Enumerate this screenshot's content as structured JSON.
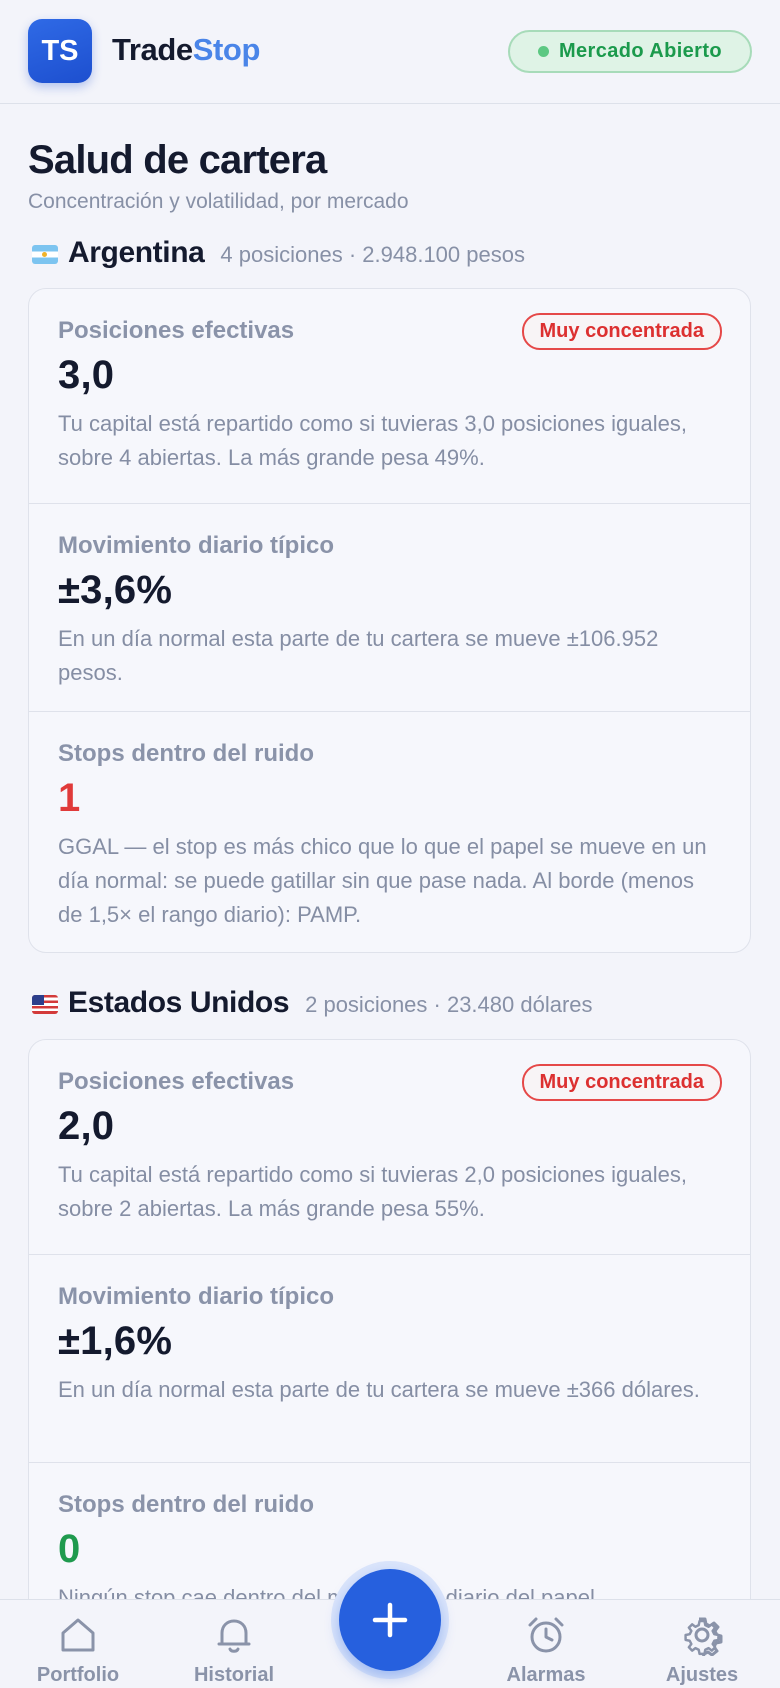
{
  "header": {
    "logo_text": "TS",
    "brand_part1": "Trade",
    "brand_part2": "Stop",
    "market_status": "Mercado Abierto"
  },
  "page": {
    "title": "Salud de cartera",
    "subtitle": "Concentración y volatilidad, por mercado"
  },
  "markets": [
    {
      "name": "Argentina",
      "flag": "argentina-flag",
      "meta": "4 posiciones · 2.948.100 pesos",
      "metrics": {
        "effective": {
          "label": "Posiciones efectivas",
          "badge": "Muy concentrada",
          "value": "3,0",
          "desc": "Tu capital está repartido como si tuvieras 3,0 posiciones iguales, sobre 4 abiertas. La más grande pesa 49%."
        },
        "daily": {
          "label": "Movimiento diario típico",
          "value": "±3,6%",
          "desc": "En un día normal esta parte de tu cartera se mueve ±106.952 pesos."
        },
        "stops": {
          "label": "Stops dentro del ruido",
          "value": "1",
          "desc": "GGAL — el stop es más chico que lo que el papel se mueve en un día normal: se puede gatillar sin que pase nada. Al borde (menos de 1,5× el rango diario): PAMP."
        }
      }
    },
    {
      "name": "Estados Unidos",
      "flag": "usa-flag",
      "meta": "2 posiciones · 23.480 dólares",
      "metrics": {
        "effective": {
          "label": "Posiciones efectivas",
          "badge": "Muy concentrada",
          "value": "2,0",
          "desc": "Tu capital está repartido como si tuvieras 2,0 posiciones iguales, sobre 2 abiertas. La más grande pesa 55%."
        },
        "daily": {
          "label": "Movimiento diario típico",
          "value": "±1,6%",
          "desc": "En un día normal esta parte de tu cartera se mueve ±366 dólares."
        },
        "stops": {
          "label": "Stops dentro del ruido",
          "value": "0",
          "desc": "Ningún stop cae dentro del movimiento diario del papel."
        }
      }
    }
  ],
  "nav": {
    "portfolio": "Portfolio",
    "historial": "Historial",
    "alarmas": "Alarmas",
    "ajustes": "Ajustes",
    "add_icon": "plus-icon"
  },
  "colors": {
    "accent": "#2660de",
    "danger": "#e03a3a",
    "success": "#1f9a4e"
  }
}
